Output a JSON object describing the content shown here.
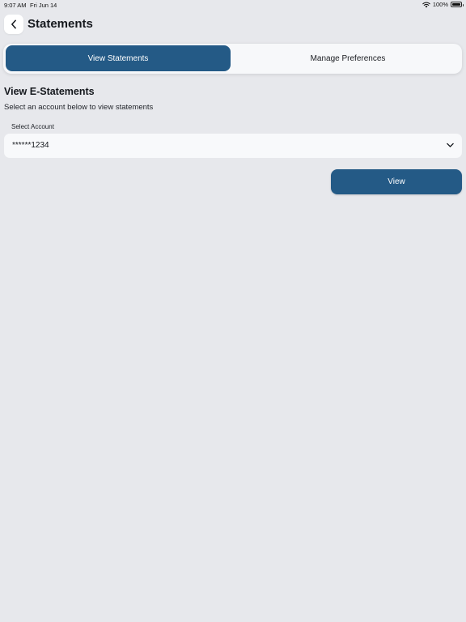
{
  "status_bar": {
    "time": "9:07 AM",
    "date": "Fri Jun 14",
    "battery": "100%"
  },
  "header": {
    "title": "Statements",
    "back_icon": "chevron-left-icon"
  },
  "tabs": [
    {
      "label": "View Statements",
      "active": true
    },
    {
      "label": "Manage Preferences",
      "active": false
    }
  ],
  "section": {
    "title": "View E-Statements",
    "subtitle": "Select an account below to view statements"
  },
  "account_select": {
    "label": "Select Account",
    "value": "******1234",
    "icon": "chevron-down-icon"
  },
  "actions": {
    "view_label": "View"
  },
  "colors": {
    "accent": "#245a86",
    "background": "#e7e8ec"
  }
}
